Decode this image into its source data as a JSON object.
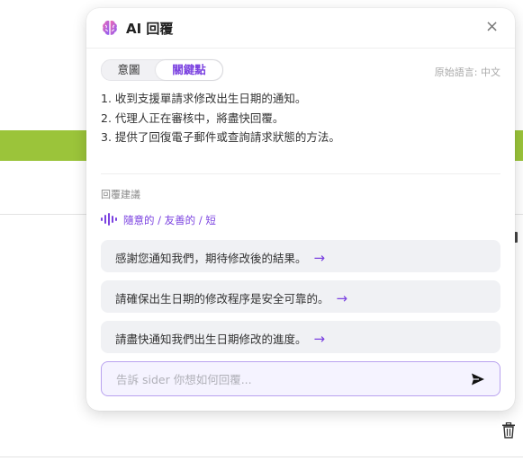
{
  "panel": {
    "title": "AI 回覆",
    "close_label": "×",
    "icons": {
      "logo": "brain-icon",
      "close": "close-icon",
      "send": "send-icon",
      "tone": "sound-wave-icon",
      "trash": "trash-icon"
    },
    "tabs": [
      {
        "label": "意圖",
        "selected": false
      },
      {
        "label": "關鍵點",
        "selected": true
      }
    ],
    "language_note": "原始語言: 中文",
    "key_points": [
      "1. 收到支援單請求修改出生日期的通知。",
      "2. 代理人正在審核中，將盡快回覆。",
      "3. 提供了回復電子郵件或查詢請求狀態的方法。"
    ],
    "suggestions_label": "回覆建議",
    "tone": "隨意的 / 友善的 / 短",
    "replies": [
      "感謝您通知我們，期待修改後的結果。",
      "請確保出生日期的修改程序是安全可靠的。",
      "請盡快通知我們出生日期修改的進度。"
    ],
    "reply_arrow": "→",
    "input_placeholder": "告訴 sider 你想如何回覆...",
    "input_value": ""
  },
  "colors": {
    "accent": "#7b42e0",
    "background_bar": "#9bc43a",
    "input_border": "#b9a2ef"
  }
}
